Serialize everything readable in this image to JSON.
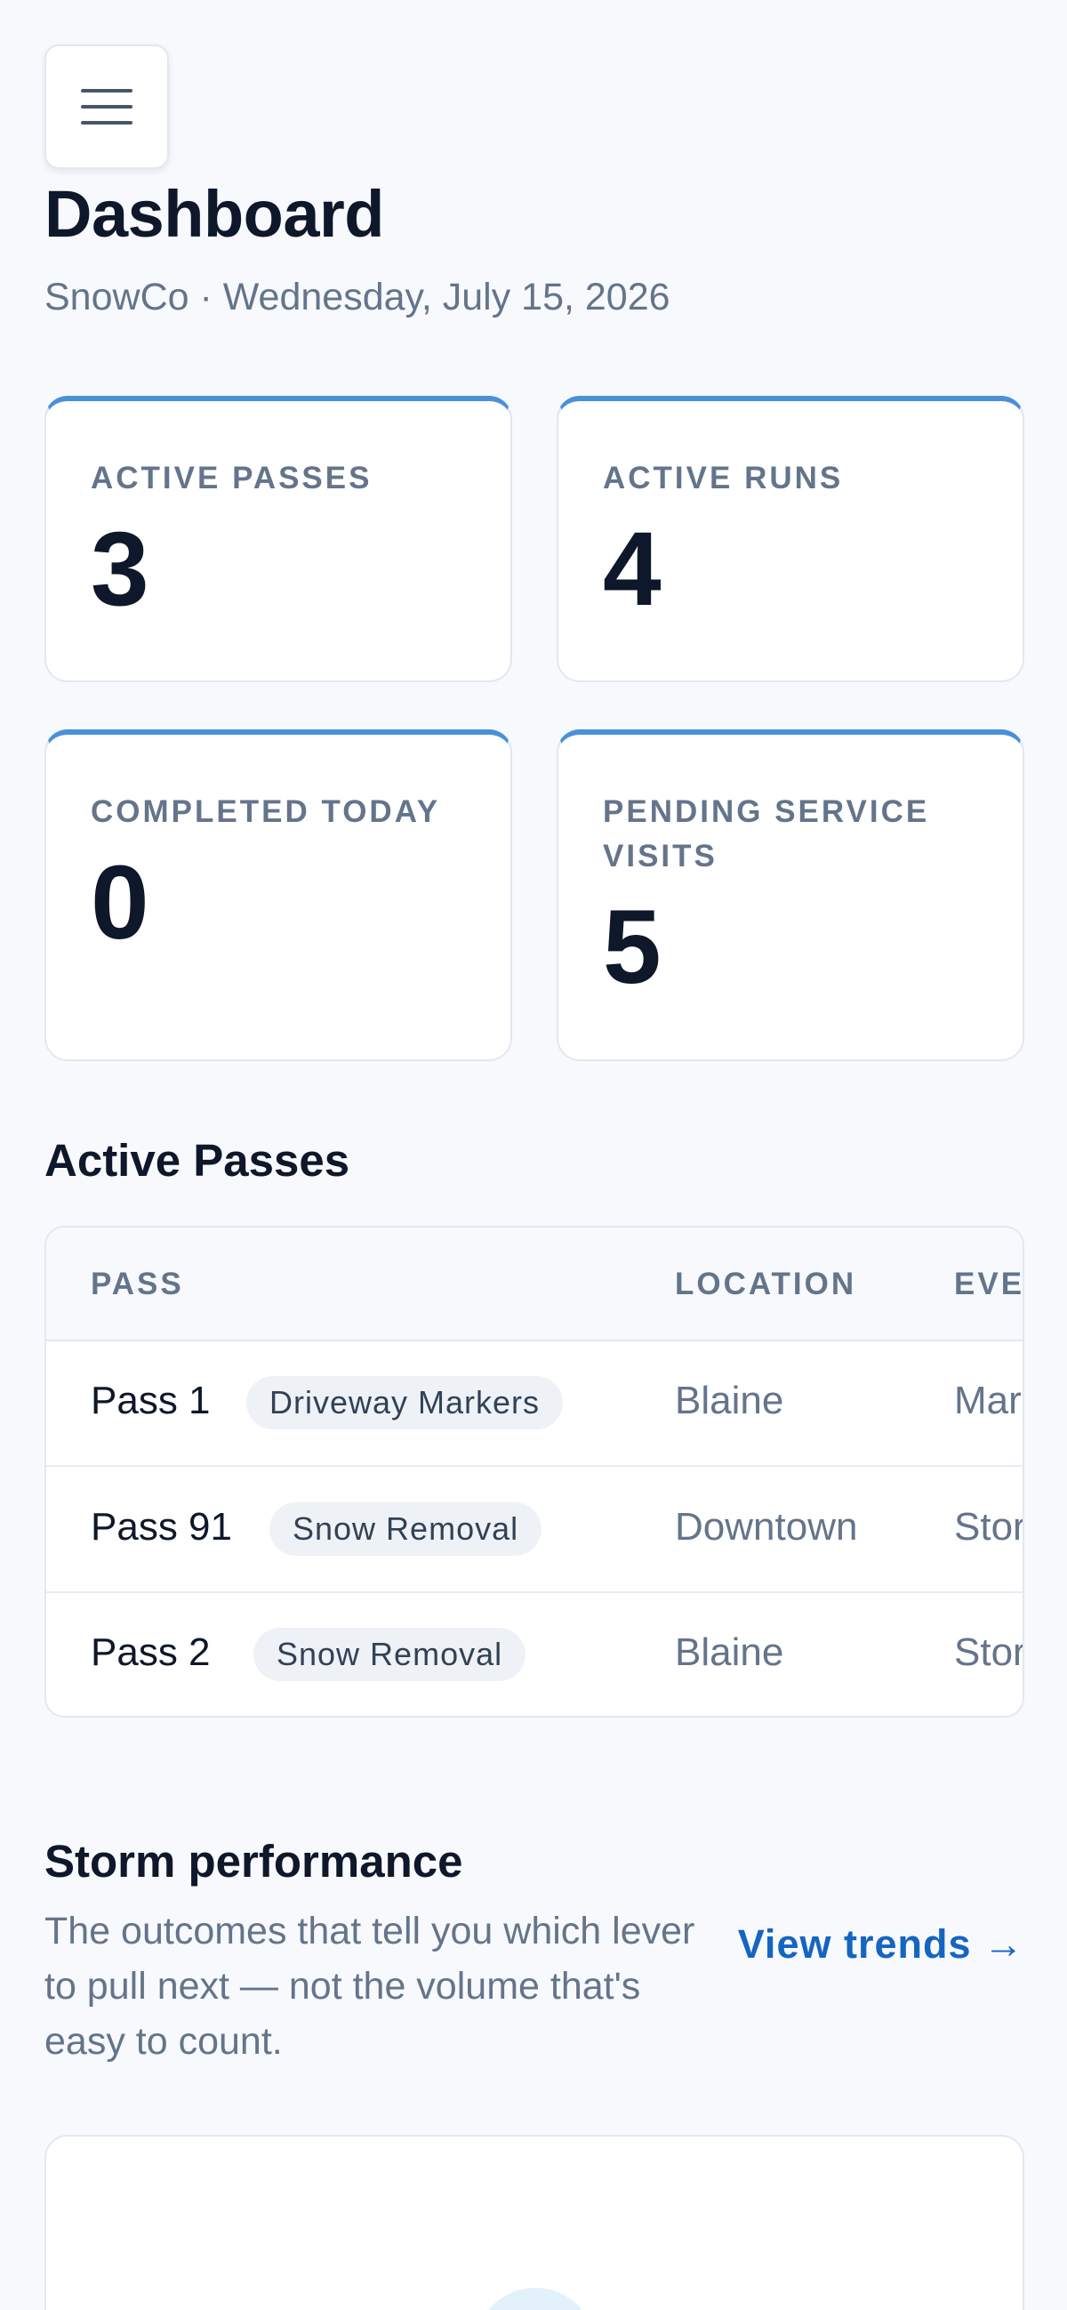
{
  "header": {
    "menu_icon": "hamburger-menu-icon",
    "title": "Dashboard",
    "subtitle": "SnowCo · Wednesday, July 15, 2026"
  },
  "stats": [
    {
      "label": "ACTIVE PASSES",
      "value": "3"
    },
    {
      "label": "ACTIVE RUNS",
      "value": "4"
    },
    {
      "label": "COMPLETED TODAY",
      "value": "0"
    },
    {
      "label": "PENDING SERVICE VISITS",
      "value": "5"
    }
  ],
  "active_passes": {
    "title": "Active Passes",
    "columns": [
      "PASS",
      "LOCATION",
      "EVE"
    ],
    "rows": [
      {
        "pass": "Pass 1",
        "tag": "Driveway Markers",
        "location": "Blaine",
        "event": "Mar"
      },
      {
        "pass": "Pass 91",
        "tag": "Snow Removal",
        "location": "Downtown",
        "event": "Stor"
      },
      {
        "pass": "Pass 2",
        "tag": "Snow Removal",
        "location": "Blaine",
        "event": "Stor"
      }
    ]
  },
  "storm": {
    "title": "Storm performance",
    "description": "The outcomes that tell you which lever to pull next — not the volume that's easy to count.",
    "link_label": "View trends →"
  },
  "colors": {
    "accent": "#4a90d9",
    "link": "#1565c0",
    "text": "#0f172a",
    "muted": "#64748b",
    "background": "#f7f9fc"
  }
}
